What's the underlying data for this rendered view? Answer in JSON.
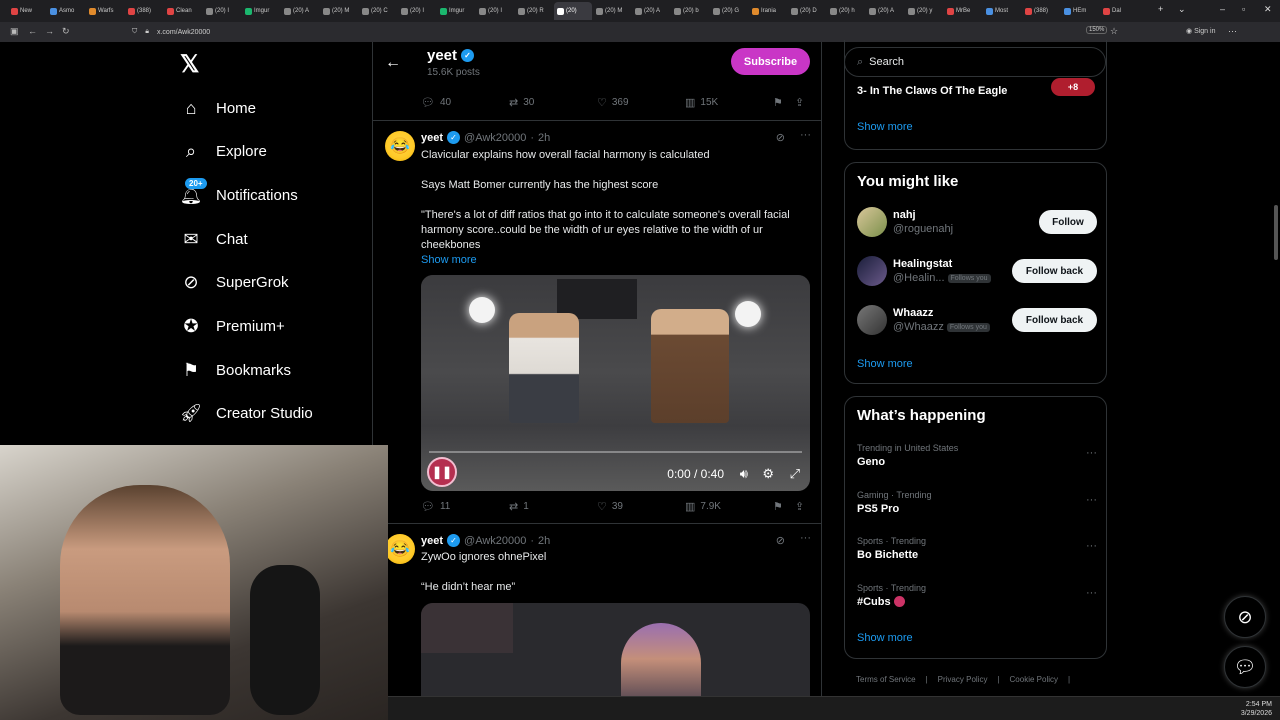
{
  "browser": {
    "tabs": [
      "New",
      "Asmo",
      "Warfs",
      "(388)",
      "Clean",
      "(20) I",
      "Imgur",
      "(20) A",
      "(20) M",
      "(20) C",
      "(20) I",
      "Imgur",
      "(20) I",
      "(20) R",
      "(20)",
      "(20) M",
      "(20) A",
      "(20) b",
      "(20) G",
      "Irania",
      "(20) D",
      "(20) h",
      "(20) A",
      "(20) y",
      "MrBe",
      "Most",
      "(388)",
      "HEm",
      "Dal"
    ],
    "active_tab_index": 14,
    "url": "x.com/Awk20000",
    "zoom": "150%",
    "sign_in": "Sign in"
  },
  "nav": {
    "items": [
      {
        "label": "Home",
        "icon": "home-icon"
      },
      {
        "label": "Explore",
        "icon": "search-icon"
      },
      {
        "label": "Notifications",
        "icon": "bell-icon",
        "badge": "20+"
      },
      {
        "label": "Chat",
        "icon": "mail-icon"
      },
      {
        "label": "SuperGrok",
        "icon": "grok-icon"
      },
      {
        "label": "Premium+",
        "icon": "verified-icon"
      },
      {
        "label": "Bookmarks",
        "icon": "bookmark-icon"
      },
      {
        "label": "Creator Studio",
        "icon": "rocket-icon"
      }
    ]
  },
  "profile_header": {
    "name": "yeet",
    "posts": "15.6K posts",
    "subscribe": "Subscribe"
  },
  "prev_tweet": {
    "replies": "40",
    "reposts": "30",
    "likes": "369",
    "views": "15K"
  },
  "tweets": [
    {
      "name": "yeet",
      "handle": "@Awk20000",
      "time": "2h",
      "lines": [
        "Clavicular explains how overall facial harmony is calculated",
        "Says Matt Bomer currently has the highest score",
        "\"There's a lot of diff ratios that go into it to calculate someone's overall facial harmony score..could be the width of ur eyes relative to the width of ur cheekbones"
      ],
      "show_more": "Show more",
      "video_time": "0:00 / 0:40",
      "replies": "11",
      "reposts": "1",
      "likes": "39",
      "views": "7.9K"
    },
    {
      "name": "yeet",
      "handle": "@Awk20000",
      "time": "2h",
      "lines": [
        "ZywOo ignores ohnePixel",
        "“He didn’t hear me”"
      ]
    }
  ],
  "right": {
    "search_placeholder": "Search",
    "top_card": {
      "item": "3- In The Claws Of The Eagle",
      "show_more": "Show more"
    },
    "might_like": {
      "title": "You might like",
      "people": [
        {
          "name": "nahj",
          "handle": "@roguenahj",
          "button": "Follow",
          "follows_you": ""
        },
        {
          "name": "Healingstat",
          "handle": "@Healin...",
          "button": "Follow back",
          "follows_you": "Follows you"
        },
        {
          "name": "Whaazz",
          "handle": "@Whaazz",
          "button": "Follow back",
          "follows_you": "Follows you"
        }
      ],
      "show_more": "Show more"
    },
    "happening": {
      "title": "What’s happening",
      "trends": [
        {
          "meta": "Trending in United States",
          "name": "Geno"
        },
        {
          "meta": "Gaming · Trending",
          "name": "PS5 Pro"
        },
        {
          "meta": "Sports · Trending",
          "name": "Bo Bichette"
        },
        {
          "meta": "Sports · Trending",
          "name": "#Cubs"
        }
      ],
      "show_more": "Show more"
    },
    "footer": [
      "Terms of Service",
      "Privacy Policy",
      "Cookie Policy"
    ]
  },
  "taskbar": {
    "time": "2:54 PM",
    "date": "3/29/2026"
  }
}
